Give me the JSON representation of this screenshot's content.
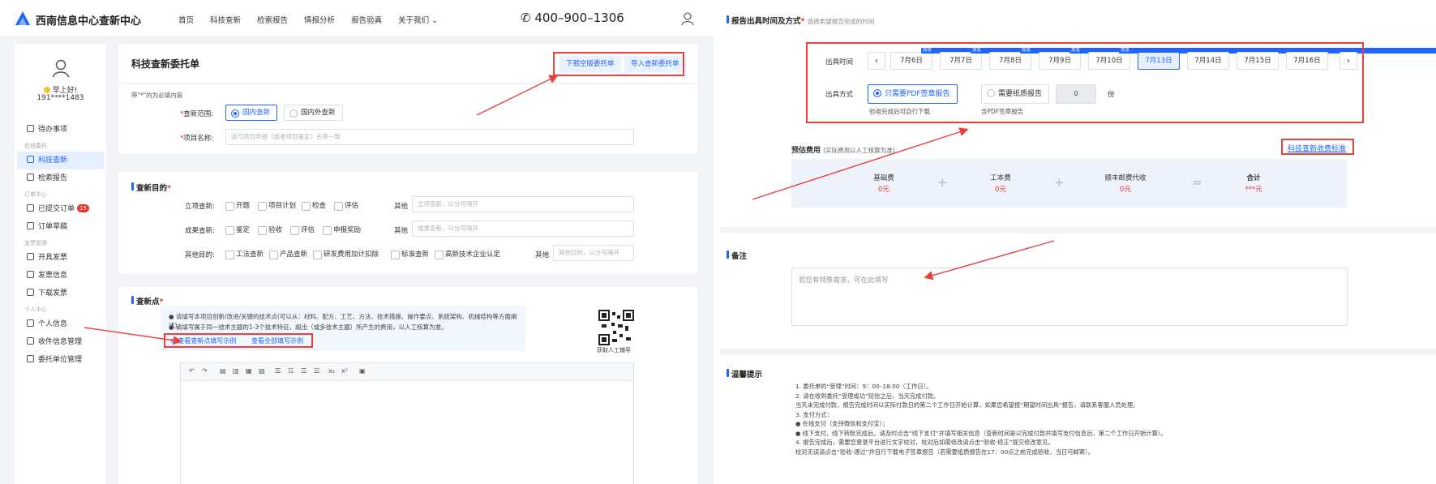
{
  "nav": {
    "brand": "西南信息中心查新中心",
    "links": [
      "首页",
      "科技查新",
      "检索报告",
      "情报分析",
      "报告验真",
      "关于我们 ⌄"
    ],
    "phone": "400–900–1306"
  },
  "sidebar": {
    "greeting": "早上好!",
    "user_id": "191****1483",
    "todo": "待办事项",
    "group_search": "在线委托",
    "item_scitech": "科技查新",
    "item_retrieval": "检索报告",
    "group_orders": "订单中心",
    "item_submitted": "已提交订单",
    "submitted_badge": "15",
    "item_drafts": "订单草稿",
    "group_invoice": "发票管理",
    "item_issue_invoice": "开具发票",
    "item_invoice_info": "发票信息",
    "item_download_invoice": "下载发票",
    "group_personal": "个人中心",
    "item_profile": "个人信息",
    "item_address": "收件信息管理",
    "item_entrust_unit": "委托单位管理"
  },
  "form": {
    "title": "科技查新委托单",
    "download_btn": "下载空版委托单",
    "import_btn": "导入查新委托单",
    "required_note": "带\"*\"的为必填内容",
    "scope_label": "查新范围:",
    "scope_domestic": "国内查新",
    "scope_foreign": "国内外查新",
    "name_label": "项目名称:",
    "name_placeholder": "请与项目申报（或者项目鉴定）名称一致"
  },
  "purpose": {
    "title": "查新目的",
    "row1_label": "立项查新:",
    "row1_opts": [
      "开题",
      "项目计划",
      "检查",
      "评估"
    ],
    "row1_other": "其他",
    "row1_ph": "立项查新，以分号隔开",
    "row2_label": "成果查新:",
    "row2_opts": [
      "鉴定",
      "验收",
      "评估",
      "申报奖励"
    ],
    "row2_other": "其他",
    "row2_ph": "成果查新，以分号隔开",
    "row3_label": "其他目的:",
    "row3_opts": [
      "工法查新",
      "产品查新",
      "研发费用加计扣除",
      "标准查新",
      "高新技术企业认定"
    ],
    "row3_other": "其他",
    "row3_ph": "其他目的，以分号隔开"
  },
  "points": {
    "title": "查新点",
    "note1": "● 请填写本项目创新/改进/关键的技术点(可以从：材料、配方、工艺、方法、技术措施、操作要点、系统架构、机械结构等方面阐述)。",
    "note2": "● 请填写属于同一技术主题的1-3个技术特征，超出（或多技术主题）所产生的费用，以人工核算为准。",
    "link_points": "查看查新点填写示例",
    "link_all": "查看全部填写示例",
    "qr_caption": "获取人工辅导",
    "toolbar": [
      "↶",
      "↷",
      "▤",
      "▥",
      "▦",
      "▧",
      "☰",
      "☷",
      "☲",
      "☱",
      "x₂",
      "x²",
      "▣"
    ]
  },
  "report": {
    "title": "报告出具时间及方式",
    "subtitle": "选择希望报告完成的时间",
    "time_label": "出具时间",
    "dates": [
      {
        "label": "7月6日",
        "tag": "加急"
      },
      {
        "label": "7月7日",
        "tag": "加急"
      },
      {
        "label": "7月8日",
        "tag": "加急"
      },
      {
        "label": "7月9日",
        "tag": "加急"
      },
      {
        "label": "7月10日",
        "tag": "加急"
      },
      {
        "label": "7月13日",
        "tag": ""
      },
      {
        "label": "7月14日",
        "tag": ""
      },
      {
        "label": "7月15日",
        "tag": ""
      },
      {
        "label": "7月16日",
        "tag": ""
      }
    ],
    "selected_date": "7月13日",
    "method_label": "出具方式",
    "method_pdf": "只需要PDF签章报告",
    "method_pdf_note": "验收完成后可自行下载",
    "method_paper": "需要纸质报告",
    "method_paper_note": "含PDF签章报告",
    "paper_count": "0",
    "paper_unit": "份"
  },
  "fee": {
    "title": "预估费用",
    "note": "(实际费用以人工核算为准)",
    "standard_link": "科技查新收费标准",
    "base_name": "基础费",
    "base_val": "0元",
    "work_name": "工本费",
    "work_val": "0元",
    "ship_name": "顺丰邮费代收",
    "ship_val": "0元",
    "total_name": "合计",
    "total_val": "***元",
    "plus": "+",
    "equals": "="
  },
  "remark": {
    "title": "备注",
    "placeholder": "若您有特殊需求，可在此填写"
  },
  "tips": {
    "title": "温馨提示",
    "lines": [
      "1. 委托单的“受理”时间：9：00–18:00（工作日）。",
      "2. 请在收到委托“受理成功”短信之后，当天完成付款。",
      "    当天未完成付款，报告完成时间以实际付款日的第二个工作日开始计算，如果您希望按“期望时间出具”报告，请联系客服人员处理。",
      "3. 支付方式：",
      "    ● 在线支付（支持微信和支付宝）；",
      "    ● 线下支付，线下转账完成后，请及时点击“线下支付”并填写相关信息（查新时间是以完成付款并填写支付信息后，第二个工作日开始计算）。",
      "4. 报告完成后，需要您登录平台进行文字校对，校对后如需修改请点击“验收-修正”提交修改意见。",
      "    校对无误请点击“验收-通过”并自行下载电子签章报告（若需要纸质报告在17：00点之前完成验收，当日可邮寄）。"
    ]
  },
  "colors": {
    "accent": "#1f66ff",
    "annotation": "#e8423c"
  }
}
